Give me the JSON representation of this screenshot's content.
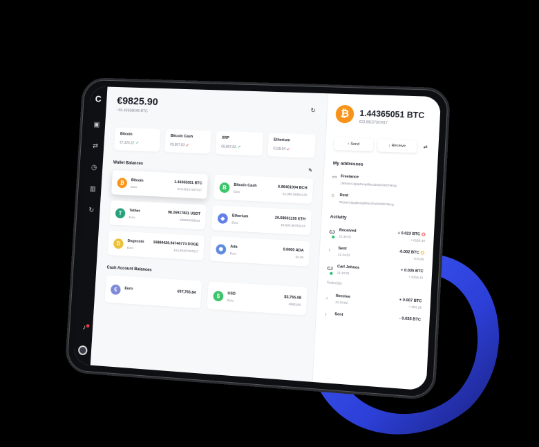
{
  "main": {
    "total": "€9825.90",
    "total_sub": "~55.43938046 BTC",
    "tickers": [
      {
        "name": "Bitcoin",
        "value": "€7,323.32",
        "trend": "up"
      },
      {
        "name": "Bitcoin Cash",
        "value": "€9,807.83",
        "trend": "down"
      },
      {
        "name": "XRP",
        "value": "€9,807.83",
        "trend": "up"
      },
      {
        "name": "Etherium",
        "value": "€128.54",
        "trend": "down"
      }
    ],
    "wallet_title": "Wallet Balances",
    "wallets": [
      {
        "name": "Bitcoin",
        "sub": "Euro",
        "amount": "1.44365051 BTC",
        "fiat": "€13,99157307617",
        "glyph": "₿",
        "color": "#f7931a"
      },
      {
        "name": "Bitcoin Cash",
        "sub": "Euro",
        "amount": "6.96401004 BCH",
        "fiat": "€1,986.59354120",
        "glyph": "B",
        "color": "#3cc56b"
      },
      {
        "name": "Tether",
        "sub": "Euro",
        "amount": "98.26917821 USDT",
        "fiat": "€86640038024",
        "glyph": "T",
        "color": "#26a17b"
      },
      {
        "name": "Etherium",
        "sub": "Euro",
        "amount": "20.68661155 ETH",
        "fiat": "€3,693.98765413",
        "glyph": "◆",
        "color": "#627eea"
      },
      {
        "name": "Dogecoin",
        "sub": "Euro",
        "amount": "16884426.94746774 DOGE",
        "fiat": "€13,99157307617",
        "glyph": "D",
        "color": "#e9c13b"
      },
      {
        "name": "Ada",
        "sub": "Euro",
        "amount": "0.0000 ADA",
        "fiat": "€0.00",
        "glyph": "✺",
        "color": "#5e8be0"
      }
    ],
    "cash_title": "Cash Account Balances",
    "cash": [
      {
        "name": "Euro",
        "sub": "",
        "amount": "€97,765.84",
        "fiat": "",
        "glyph": "€",
        "color": "#7f8ad8"
      },
      {
        "name": "USD",
        "sub": "Euro",
        "amount": "$3,765.08",
        "fiat": "€982165",
        "glyph": "$",
        "color": "#3cc56b"
      }
    ]
  },
  "detail": {
    "amount": "1.44365051 BTC",
    "fiat": "€13,99157307617",
    "send_label": "Send",
    "receive_label": "Receive",
    "addresses_title": "My addresses",
    "addresses": [
      {
        "name": "Freelance",
        "key": "1M5owVL9pqMompMfan3Zwk3mbb79Kvty",
        "icon": "monitor-icon"
      },
      {
        "name": "Rent",
        "key": "82ysaVL9pqMompMfan3Zwk3mbb79Kvty",
        "icon": "home-icon"
      }
    ],
    "activity_title": "Activity",
    "activity": [
      {
        "icon": "CJ",
        "label": "Received",
        "time": "21:34:02",
        "amount": "+ 0.023 BTC",
        "fiat": "+ €168.44",
        "status": "red"
      },
      {
        "icon": "↑",
        "label": "Sent",
        "time": "21:34:02",
        "amount": "-0.002 BTC",
        "fiat": "- €74.65",
        "status": "yellow"
      },
      {
        "icon": "CJ",
        "label": "Carl Johnes",
        "time": "21:34:02",
        "amount": "+ 0.035 BTC",
        "fiat": "+ €256.32",
        "status": ""
      }
    ],
    "yesterday_label": "Yesterday",
    "activity_yesterday": [
      {
        "icon": "↓",
        "label": "Receive",
        "time": "21:34:02",
        "amount": "+ 0.007 BTC",
        "fiat": "+ €51.26",
        "status": ""
      },
      {
        "icon": "↑",
        "label": "Sent",
        "time": "",
        "amount": "- 0.035 BTC",
        "fiat": "",
        "status": ""
      }
    ]
  }
}
